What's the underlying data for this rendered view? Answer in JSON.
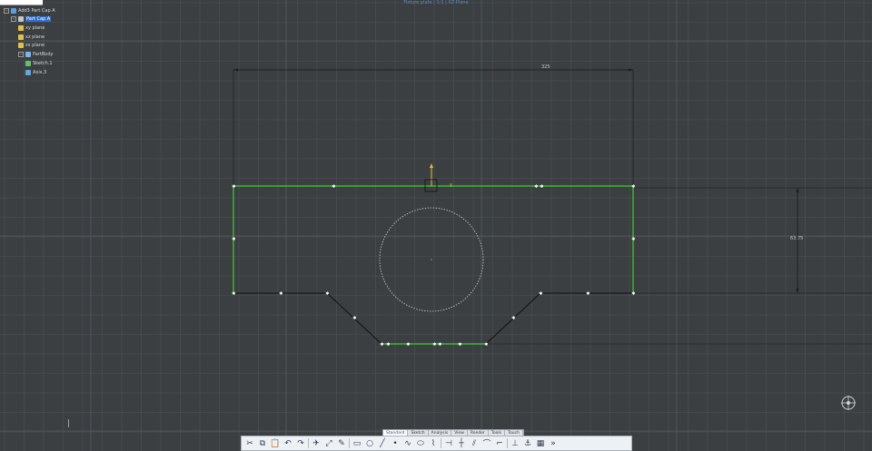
{
  "window": {
    "title": "Fixture plate | 1:1 | XZ-Plane"
  },
  "tree": {
    "root": {
      "label": "Add3 Part Cap A"
    },
    "items": [
      {
        "label": "Part Cap A",
        "selected": true
      },
      {
        "label": "xy plane"
      },
      {
        "label": "xz plane"
      },
      {
        "label": "zx plane"
      },
      {
        "label": "PartBody"
      },
      {
        "label": "Sketch.1"
      },
      {
        "label": "Axis.3"
      }
    ]
  },
  "sketch": {
    "dimension_horizontal": "325",
    "dimension_vertical": "63.75",
    "profile_color": "#3bd12f",
    "construction_color": "#d0d0d0",
    "axis_color": "#e8c316"
  },
  "workbench_tabs": [
    {
      "label": "Standard",
      "active": true
    },
    {
      "label": "Sketch"
    },
    {
      "label": "Analysis"
    },
    {
      "label": "View"
    },
    {
      "label": "Render"
    },
    {
      "label": "Tools"
    },
    {
      "label": "Touch"
    }
  ],
  "toolbar": {
    "icons": [
      "cut-icon",
      "copy-icon",
      "paste-icon",
      "undo-icon",
      "redo-icon",
      "fly-icon",
      "fit-all-icon",
      "sketch-icon",
      "rectangle-icon",
      "circle-icon",
      "line-icon",
      "point-icon",
      "spline-icon",
      "ellipse-icon",
      "profile-icon",
      "trim-icon",
      "axis-icon",
      "offset-icon",
      "corner-icon",
      "chamfer-icon",
      "constraint-icon",
      "fix-icon",
      "grid-icon",
      "more-icon"
    ]
  }
}
